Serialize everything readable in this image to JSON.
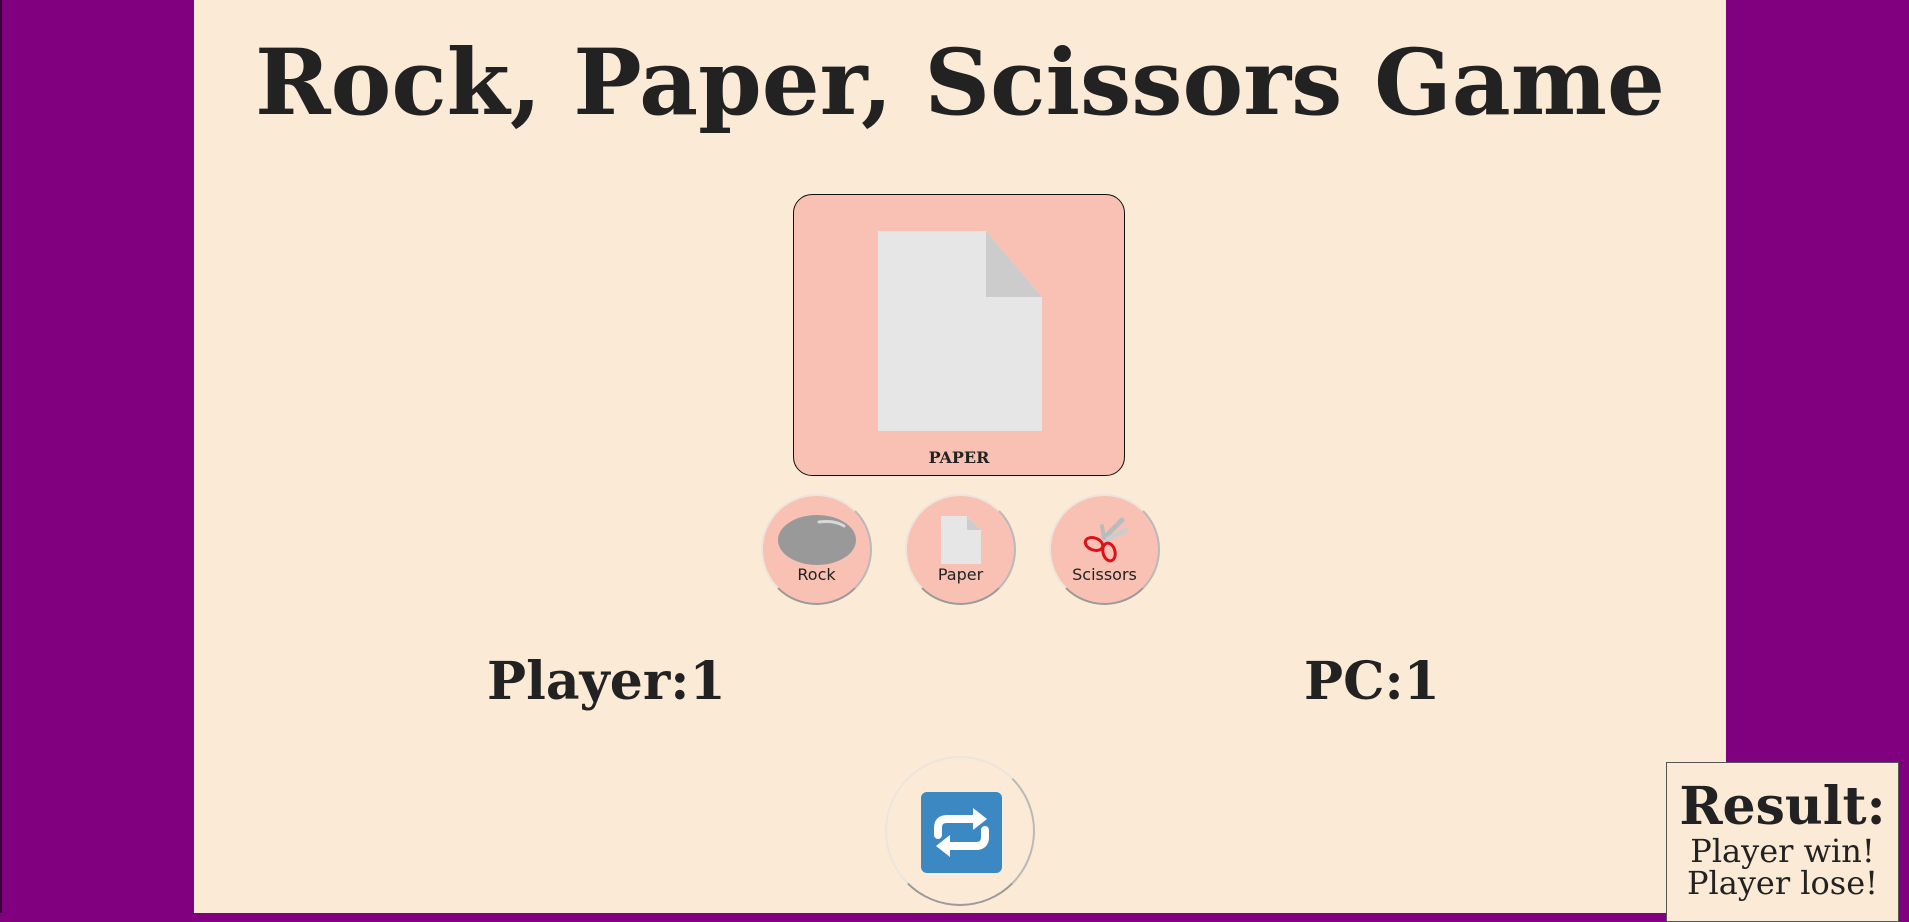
{
  "game": {
    "title": "Rock, Paper, Scissors Game"
  },
  "display": {
    "selected_label": "PAPER",
    "selected_icon": "paper-icon"
  },
  "choices": [
    {
      "label": "Rock",
      "icon": "rock-icon"
    },
    {
      "label": "Paper",
      "icon": "paper-icon"
    },
    {
      "label": "Scissors",
      "icon": "scissors-icon"
    }
  ],
  "scores": {
    "player": "Player:1",
    "pc": "PC:1"
  },
  "reset": {
    "icon": "repeat-arrows-icon"
  },
  "result": {
    "title": "Result:",
    "lines": [
      "Player win!",
      "Player lose!"
    ]
  },
  "colors": {
    "frame": "#800080",
    "panel": "#FBEBD6",
    "card": "#F9C1B3",
    "reset_icon": "#3B88C3"
  }
}
